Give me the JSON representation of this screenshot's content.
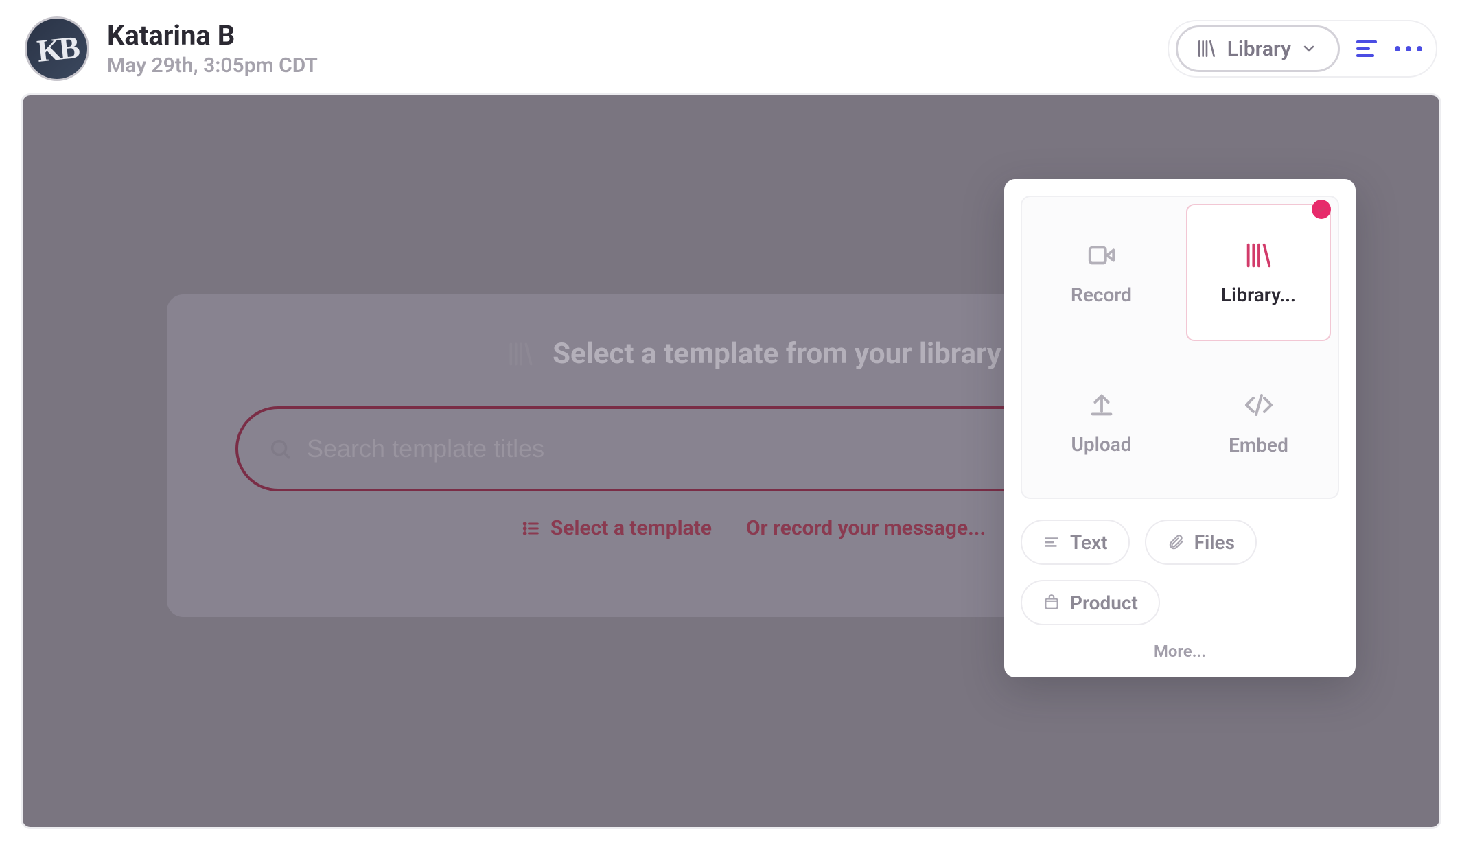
{
  "user": {
    "initials": "KB",
    "name": "Katarina B",
    "meta": "May 29th, 3:05pm CDT"
  },
  "header": {
    "library_label": "Library"
  },
  "modal": {
    "title": "Select a template from your library",
    "search_placeholder": "Search template titles",
    "select_template": "Select a template",
    "or_record": "Or record your message..."
  },
  "popover": {
    "tiles": {
      "record": "Record",
      "library": "Library...",
      "upload": "Upload",
      "embed": "Embed"
    },
    "chips": {
      "text": "Text",
      "files": "Files",
      "product": "Product"
    },
    "more": "More..."
  }
}
